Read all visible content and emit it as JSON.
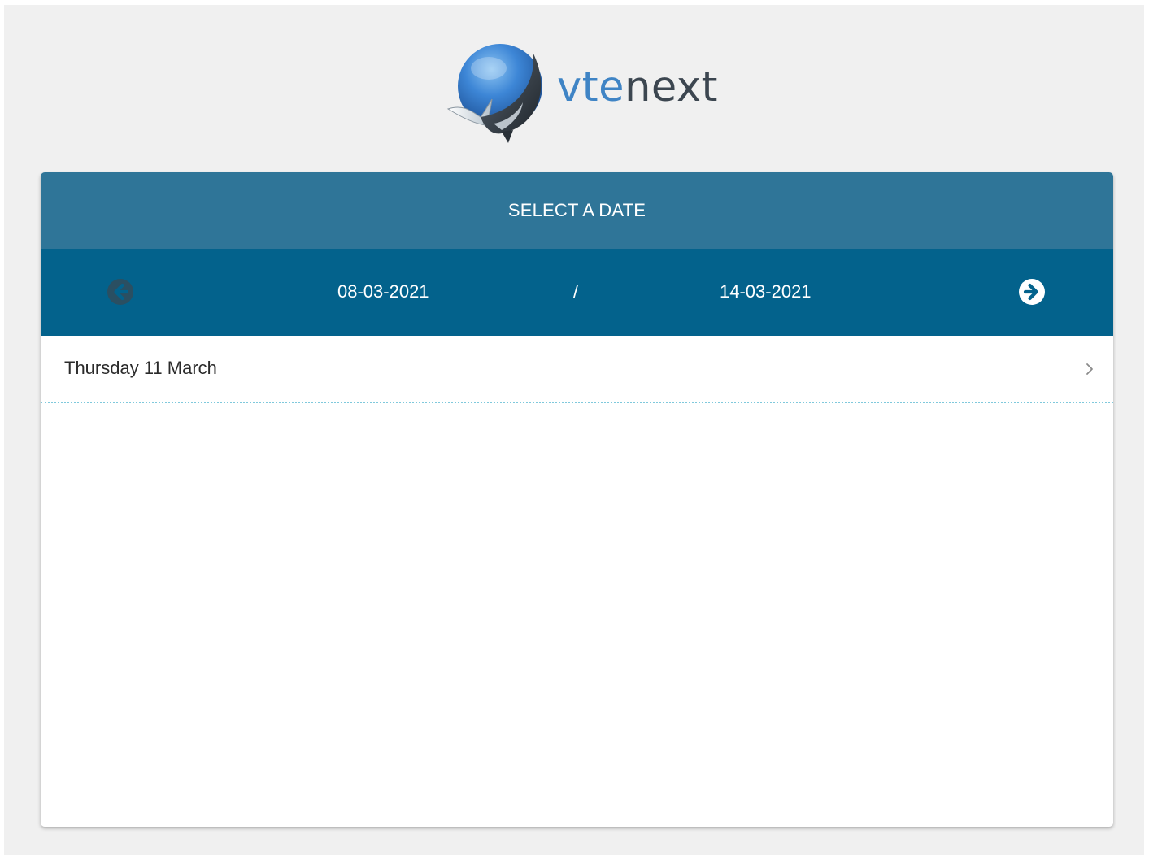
{
  "brand": {
    "logo_text_part1": "vte",
    "logo_text_part2": "next",
    "logo_icon": "whale-globe-icon"
  },
  "calendar": {
    "title": "SELECT A DATE",
    "range_start": "08-03-2021",
    "range_separator": "/",
    "range_end": "14-03-2021",
    "prev_icon": "arrow-left-circle-icon",
    "next_icon": "arrow-right-circle-icon",
    "prev_enabled": false,
    "next_enabled": true
  },
  "days": [
    {
      "label": "Thursday 11 March",
      "icon": "chevron-right-icon"
    }
  ],
  "colors": {
    "page_background": "#f0f0f0",
    "header_background": "#2f7598",
    "nav_background": "#03628c",
    "divider": "#7fc9dc",
    "logo_blue": "#3f84c5",
    "logo_dark": "#3c4650"
  }
}
